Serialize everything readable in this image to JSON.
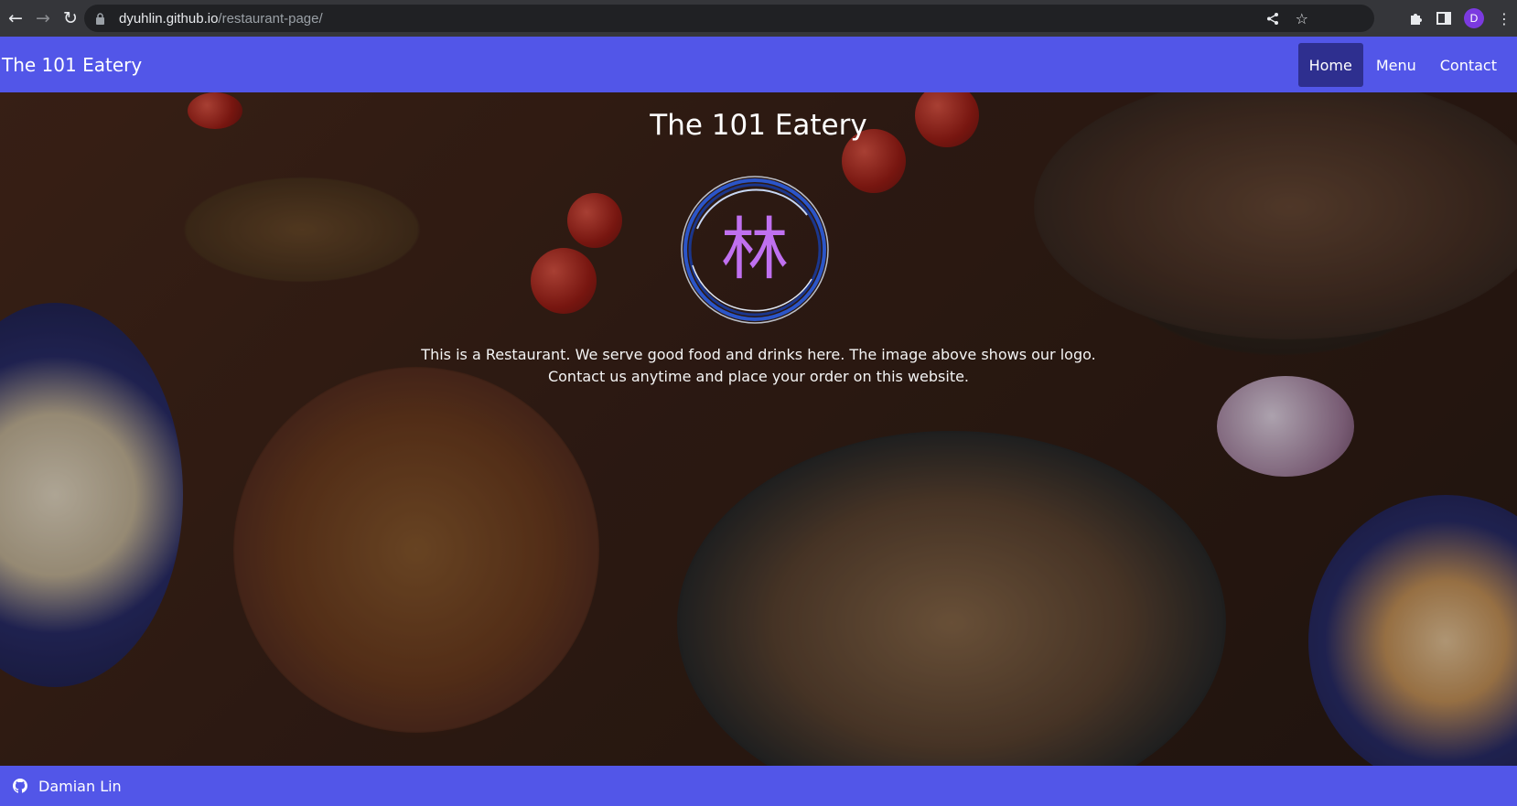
{
  "browser": {
    "url_host": "dyuhlin.github.io",
    "url_path": "/restaurant-page/",
    "profile_initial": "D"
  },
  "header": {
    "brand": "The 101 Eatery",
    "nav": [
      {
        "label": "Home",
        "active": true
      },
      {
        "label": "Menu",
        "active": false
      },
      {
        "label": "Contact",
        "active": false
      }
    ]
  },
  "hero": {
    "title": "The 101 Eatery",
    "logo_char": "林",
    "description_line1": "This is a Restaurant. We serve good food and drinks here. The image above shows our logo.",
    "description_line2": "Contact us anytime and place your order on this website."
  },
  "footer": {
    "author": "Damian Lin"
  },
  "colors": {
    "brand": "#5256e8",
    "nav_active": "#2e2f8f",
    "logo_glyph": "#c070f0"
  },
  "icons": [
    "back-arrow-icon",
    "forward-arrow-icon",
    "reload-icon",
    "lock-icon",
    "share-icon",
    "star-icon",
    "extensions-icon",
    "side-panel-icon",
    "menu-kebab-icon",
    "github-icon"
  ]
}
